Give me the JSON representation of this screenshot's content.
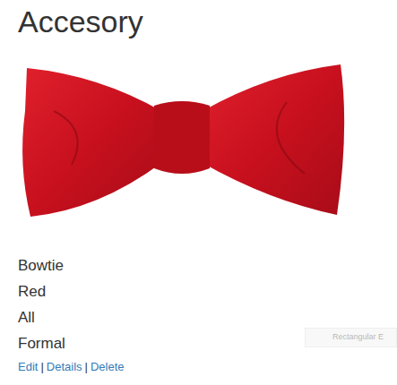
{
  "page": {
    "heading": "Accesory"
  },
  "item": {
    "fields": [
      "Bowtie",
      "Red",
      "All",
      "Formal"
    ]
  },
  "links": [
    {
      "label": "Edit"
    },
    {
      "label": "Details"
    },
    {
      "label": "Delete"
    }
  ],
  "link_separator": "|",
  "ghost_field": {
    "text": "Rectangular E"
  }
}
